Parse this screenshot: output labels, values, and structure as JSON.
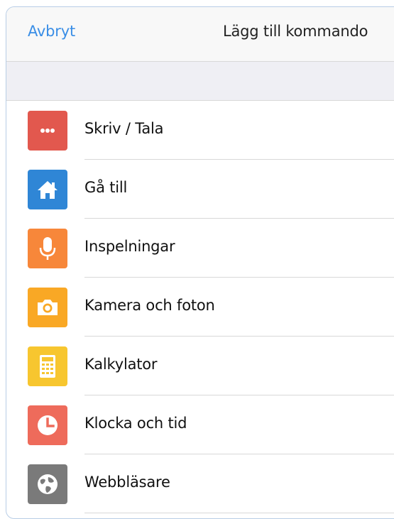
{
  "header": {
    "cancel_label": "Avbryt",
    "title": "Lägg till kommando"
  },
  "commands": [
    {
      "label": "Skriv / Tala",
      "icon": "ellipsis-icon",
      "color": "#e2584e"
    },
    {
      "label": "Gå till",
      "icon": "home-icon",
      "color": "#2f86d6"
    },
    {
      "label": "Inspelningar",
      "icon": "microphone-icon",
      "color": "#f7873a"
    },
    {
      "label": "Kamera och foton",
      "icon": "camera-icon",
      "color": "#f9a825"
    },
    {
      "label": "Kalkylator",
      "icon": "calculator-icon",
      "color": "#f7c62f"
    },
    {
      "label": "Klocka och tid",
      "icon": "clock-icon",
      "color": "#ee6b5b"
    },
    {
      "label": "Webbläsare",
      "icon": "globe-icon",
      "color": "#7a7a7a"
    }
  ],
  "colors": {
    "accent": "#3a8ee6",
    "separator": "#d8d8d8",
    "section_background": "#efeff4"
  }
}
